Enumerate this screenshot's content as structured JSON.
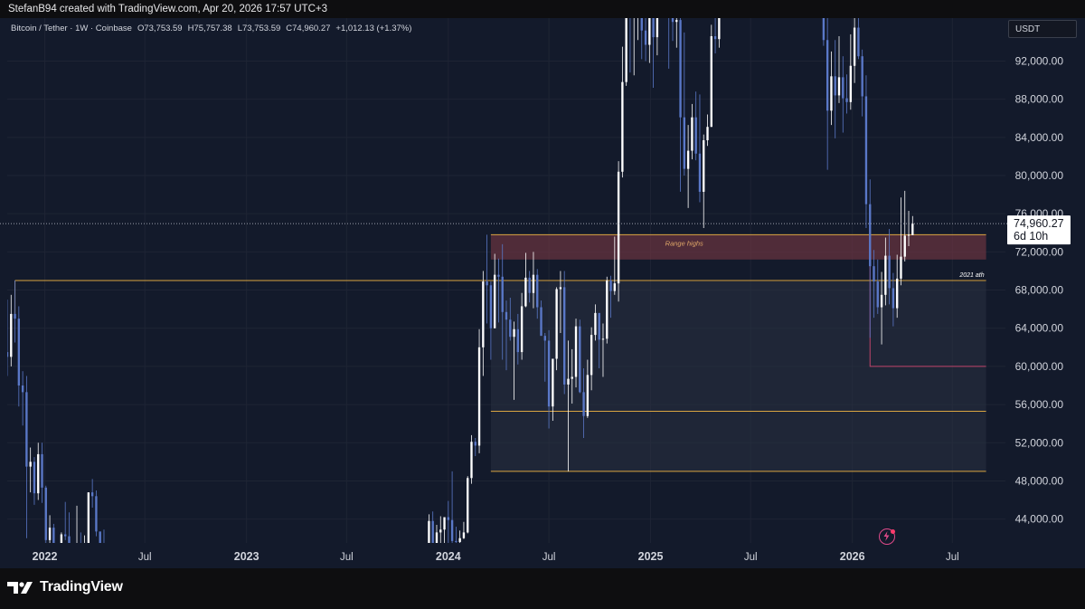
{
  "header": {
    "attribution": "StefanB94 created with TradingView.com, Apr 20, 2026 17:57 UTC+3"
  },
  "legend": {
    "symbol": "Bitcoin / Tether · 1W · Coinbase",
    "open": "O73,753.59",
    "high": "H75,757.38",
    "low": "L73,753.59",
    "close": "C74,960.27",
    "change": "+1,012.13 (+1.37%)"
  },
  "currency_button": "USDT",
  "price_tag": {
    "price": "74,960.27",
    "countdown": "6d 10h"
  },
  "footer": {
    "brand": "TradingView"
  },
  "colors": {
    "background": "#131a2b",
    "candle_up": "#ffffff",
    "candle_down": "#5a78c8",
    "range_highs_zone": "#6b3440",
    "level_line": "#d9a441",
    "low_box_border": "#c0446a"
  },
  "chart_data": {
    "type": "candlestick",
    "interval": "1W",
    "currency": "USDT",
    "y_ticks": [
      "44,000.00",
      "48,000.00",
      "52,000.00",
      "56,000.00",
      "60,000.00",
      "64,000.00",
      "68,000.00",
      "72,000.00",
      "76,000.00",
      "80,000.00",
      "84,000.00",
      "88,000.00",
      "92,000.00"
    ],
    "y_tick_values": [
      44000,
      48000,
      52000,
      56000,
      60000,
      64000,
      68000,
      72000,
      76000,
      80000,
      84000,
      88000,
      92000
    ],
    "ylim": [
      41500,
      96500
    ],
    "x_ticks": [
      {
        "label": "2022",
        "date": "2022-01-01",
        "bold": true
      },
      {
        "label": "Jul",
        "date": "2022-07-01",
        "bold": false
      },
      {
        "label": "2023",
        "date": "2023-01-01",
        "bold": true
      },
      {
        "label": "Jul",
        "date": "2023-07-01",
        "bold": false
      },
      {
        "label": "2024",
        "date": "2024-01-01",
        "bold": true
      },
      {
        "label": "Jul",
        "date": "2024-07-01",
        "bold": false
      },
      {
        "label": "2025",
        "date": "2025-01-01",
        "bold": true
      },
      {
        "label": "Jul",
        "date": "2025-07-01",
        "bold": false
      },
      {
        "label": "2026",
        "date": "2026-01-01",
        "bold": true
      },
      {
        "label": "Jul",
        "date": "2026-07-01",
        "bold": false
      }
    ],
    "xlim": [
      "2021-10-25",
      "2026-10-05"
    ],
    "last_price": 74960.27,
    "zones": [
      {
        "label": "Range highs",
        "from_date": "2024-03-18",
        "to_date": "2026-08-31",
        "y_low": 71200,
        "y_high": 73800
      },
      {
        "from_date": "2024-03-18",
        "to_date": "2026-08-31",
        "y_low": 49000,
        "y_high": 68900
      }
    ],
    "levels": [
      {
        "label": "2021 ath",
        "y": 69000,
        "from_date": "2021-11-08",
        "to_date": "2026-08-31"
      },
      {
        "y": 73800,
        "from_date": "2024-03-18",
        "to_date": "2026-08-31"
      },
      {
        "y": 55300,
        "from_date": "2024-03-18",
        "to_date": "2026-08-31"
      },
      {
        "y": 49000,
        "from_date": "2024-03-18",
        "to_date": "2026-08-31"
      }
    ],
    "box": {
      "from_date": "2026-02-02",
      "to_date": "2026-08-31",
      "y_top": 73800,
      "y_bottom": 60000
    },
    "candles": [
      {
        "date": "2021-10-25",
        "o": 61500,
        "h": 67000,
        "l": 59000,
        "c": 61000
      },
      {
        "date": "2021-11-01",
        "o": 61000,
        "h": 67500,
        "l": 60000,
        "c": 65500
      },
      {
        "date": "2021-11-08",
        "o": 65500,
        "h": 69000,
        "l": 62500,
        "c": 65000
      },
      {
        "date": "2021-11-15",
        "o": 65000,
        "h": 66300,
        "l": 55800,
        "c": 58000
      },
      {
        "date": "2021-11-22",
        "o": 58000,
        "h": 59500,
        "l": 53800,
        "c": 57300
      },
      {
        "date": "2021-11-29",
        "o": 57300,
        "h": 59000,
        "l": 42000,
        "c": 49500
      },
      {
        "date": "2021-12-06",
        "o": 49500,
        "h": 51500,
        "l": 46800,
        "c": 50000
      },
      {
        "date": "2021-12-13",
        "o": 50000,
        "h": 50500,
        "l": 45500,
        "c": 46700
      },
      {
        "date": "2021-12-20",
        "o": 46700,
        "h": 52000,
        "l": 46000,
        "c": 50800
      },
      {
        "date": "2021-12-27",
        "o": 50800,
        "h": 52000,
        "l": 45700,
        "c": 47300
      },
      {
        "date": "2022-01-03",
        "o": 47300,
        "h": 47500,
        "l": 40800,
        "c": 41800
      },
      {
        "date": "2022-01-10",
        "o": 41800,
        "h": 44400,
        "l": 39800,
        "c": 43100
      },
      {
        "date": "2022-01-17",
        "o": 43100,
        "h": 43500,
        "l": 34000,
        "c": 36300
      },
      {
        "date": "2022-01-24",
        "o": 36300,
        "h": 38900,
        "l": 33000,
        "c": 37900
      },
      {
        "date": "2022-01-31",
        "o": 37900,
        "h": 42600,
        "l": 36300,
        "c": 42400
      },
      {
        "date": "2022-02-07",
        "o": 42400,
        "h": 45800,
        "l": 41800,
        "c": 42200
      },
      {
        "date": "2022-02-14",
        "o": 42200,
        "h": 44700,
        "l": 38000,
        "c": 38300
      },
      {
        "date": "2022-02-21",
        "o": 38300,
        "h": 40000,
        "l": 34300,
        "c": 37700
      },
      {
        "date": "2022-02-28",
        "o": 37700,
        "h": 45400,
        "l": 37400,
        "c": 38400
      },
      {
        "date": "2022-03-07",
        "o": 38400,
        "h": 42600,
        "l": 37200,
        "c": 37800
      },
      {
        "date": "2022-03-14",
        "o": 37800,
        "h": 42300,
        "l": 37600,
        "c": 41300
      },
      {
        "date": "2022-03-21",
        "o": 41300,
        "h": 46800,
        "l": 40500,
        "c": 46800
      },
      {
        "date": "2022-03-28",
        "o": 46800,
        "h": 48200,
        "l": 45200,
        "c": 46400
      },
      {
        "date": "2022-04-04",
        "o": 46400,
        "h": 47000,
        "l": 42200,
        "c": 42700
      },
      {
        "date": "2022-04-11",
        "o": 42700,
        "h": 41500,
        "l": 38500,
        "c": 40400
      },
      {
        "date": "2022-04-18",
        "o": 40400,
        "h": 42900,
        "l": 38500,
        "c": 39400
      },
      {
        "date": "2023-11-27",
        "o": 37700,
        "h": 44500,
        "l": 37500,
        "c": 43800
      },
      {
        "date": "2023-12-04",
        "o": 43800,
        "h": 44800,
        "l": 40200,
        "c": 41400
      },
      {
        "date": "2023-12-11",
        "o": 41400,
        "h": 43400,
        "l": 40500,
        "c": 42600
      },
      {
        "date": "2023-12-18",
        "o": 42600,
        "h": 44300,
        "l": 40900,
        "c": 42900
      },
      {
        "date": "2023-12-25",
        "o": 42900,
        "h": 43800,
        "l": 41300,
        "c": 44200
      },
      {
        "date": "2024-01-01",
        "o": 44200,
        "h": 45900,
        "l": 40700,
        "c": 43900
      },
      {
        "date": "2024-01-08",
        "o": 43900,
        "h": 49000,
        "l": 41500,
        "c": 41700
      },
      {
        "date": "2024-01-15",
        "o": 41700,
        "h": 43200,
        "l": 40300,
        "c": 41600
      },
      {
        "date": "2024-01-22",
        "o": 41600,
        "h": 42800,
        "l": 38500,
        "c": 42000
      },
      {
        "date": "2024-01-29",
        "o": 42000,
        "h": 43700,
        "l": 41900,
        "c": 42600
      },
      {
        "date": "2024-02-05",
        "o": 42600,
        "h": 48500,
        "l": 42500,
        "c": 48300
      },
      {
        "date": "2024-02-12",
        "o": 48300,
        "h": 52800,
        "l": 47700,
        "c": 52100
      },
      {
        "date": "2024-02-19",
        "o": 52100,
        "h": 52500,
        "l": 50600,
        "c": 51700
      },
      {
        "date": "2024-02-26",
        "o": 51700,
        "h": 63900,
        "l": 50900,
        "c": 62000
      },
      {
        "date": "2024-03-04",
        "o": 62000,
        "h": 70000,
        "l": 59000,
        "c": 68900
      },
      {
        "date": "2024-03-11",
        "o": 68900,
        "h": 73800,
        "l": 64500,
        "c": 68500
      },
      {
        "date": "2024-03-18",
        "o": 68500,
        "h": 68900,
        "l": 60700,
        "c": 64000
      },
      {
        "date": "2024-03-25",
        "o": 64000,
        "h": 71800,
        "l": 64000,
        "c": 69600
      },
      {
        "date": "2024-04-01",
        "o": 69600,
        "h": 71300,
        "l": 64600,
        "c": 69400
      },
      {
        "date": "2024-04-08",
        "o": 69400,
        "h": 72800,
        "l": 60700,
        "c": 65700
      },
      {
        "date": "2024-04-15",
        "o": 65700,
        "h": 66900,
        "l": 59600,
        "c": 64900
      },
      {
        "date": "2024-04-22",
        "o": 64900,
        "h": 67200,
        "l": 62700,
        "c": 63100
      },
      {
        "date": "2024-04-29",
        "o": 63100,
        "h": 64700,
        "l": 56500,
        "c": 63900
      },
      {
        "date": "2024-05-06",
        "o": 63900,
        "h": 65500,
        "l": 60200,
        "c": 61500
      },
      {
        "date": "2024-05-13",
        "o": 61500,
        "h": 67700,
        "l": 60700,
        "c": 66300
      },
      {
        "date": "2024-05-20",
        "o": 66300,
        "h": 71900,
        "l": 66200,
        "c": 69300
      },
      {
        "date": "2024-05-27",
        "o": 69300,
        "h": 70000,
        "l": 66700,
        "c": 67700
      },
      {
        "date": "2024-06-03",
        "o": 67700,
        "h": 72000,
        "l": 66100,
        "c": 69600
      },
      {
        "date": "2024-06-10",
        "o": 69600,
        "h": 70200,
        "l": 65000,
        "c": 66200
      },
      {
        "date": "2024-06-17",
        "o": 66200,
        "h": 66900,
        "l": 63500,
        "c": 63200
      },
      {
        "date": "2024-06-24",
        "o": 63200,
        "h": 63500,
        "l": 58400,
        "c": 62700
      },
      {
        "date": "2024-07-01",
        "o": 62700,
        "h": 63800,
        "l": 53500,
        "c": 55800
      },
      {
        "date": "2024-07-08",
        "o": 55800,
        "h": 59500,
        "l": 54300,
        "c": 60800
      },
      {
        "date": "2024-07-15",
        "o": 60800,
        "h": 68300,
        "l": 59600,
        "c": 68100
      },
      {
        "date": "2024-07-22",
        "o": 68100,
        "h": 70000,
        "l": 63500,
        "c": 68300
      },
      {
        "date": "2024-07-29",
        "o": 68300,
        "h": 70000,
        "l": 57100,
        "c": 58100
      },
      {
        "date": "2024-08-05",
        "o": 58100,
        "h": 62700,
        "l": 49000,
        "c": 58700
      },
      {
        "date": "2024-08-12",
        "o": 58700,
        "h": 61800,
        "l": 56100,
        "c": 58900
      },
      {
        "date": "2024-08-19",
        "o": 58900,
        "h": 65000,
        "l": 57800,
        "c": 64200
      },
      {
        "date": "2024-08-26",
        "o": 64200,
        "h": 64900,
        "l": 57200,
        "c": 57300
      },
      {
        "date": "2024-09-02",
        "o": 57300,
        "h": 59800,
        "l": 52500,
        "c": 54800
      },
      {
        "date": "2024-09-09",
        "o": 54800,
        "h": 60700,
        "l": 54600,
        "c": 59100
      },
      {
        "date": "2024-09-16",
        "o": 59100,
        "h": 64100,
        "l": 57500,
        "c": 63300
      },
      {
        "date": "2024-09-23",
        "o": 63300,
        "h": 66500,
        "l": 62700,
        "c": 65600
      },
      {
        "date": "2024-09-30",
        "o": 65600,
        "h": 65500,
        "l": 59800,
        "c": 62800
      },
      {
        "date": "2024-10-07",
        "o": 62800,
        "h": 64500,
        "l": 58900,
        "c": 62900
      },
      {
        "date": "2024-10-14",
        "o": 62900,
        "h": 69400,
        "l": 62400,
        "c": 69000
      },
      {
        "date": "2024-10-21",
        "o": 69000,
        "h": 69500,
        "l": 65100,
        "c": 67900
      },
      {
        "date": "2024-10-28",
        "o": 67900,
        "h": 73600,
        "l": 67500,
        "c": 68700
      },
      {
        "date": "2024-11-04",
        "o": 68700,
        "h": 81500,
        "l": 66800,
        "c": 80400
      },
      {
        "date": "2024-11-11",
        "o": 80400,
        "h": 93500,
        "l": 79800,
        "c": 89800
      },
      {
        "date": "2024-11-18",
        "o": 89800,
        "h": 99800,
        "l": 89400,
        "c": 97900
      },
      {
        "date": "2024-11-25",
        "o": 97900,
        "h": 98900,
        "l": 90800,
        "c": 97300
      },
      {
        "date": "2024-12-02",
        "o": 97300,
        "h": 104000,
        "l": 90500,
        "c": 101200
      },
      {
        "date": "2024-12-09",
        "o": 101200,
        "h": 107800,
        "l": 94200,
        "c": 106000
      },
      {
        "date": "2024-12-16",
        "o": 106000,
        "h": 108300,
        "l": 92200,
        "c": 95200
      },
      {
        "date": "2024-12-23",
        "o": 95200,
        "h": 99900,
        "l": 92000,
        "c": 93700
      },
      {
        "date": "2024-12-30",
        "o": 93700,
        "h": 102700,
        "l": 91800,
        "c": 98300
      },
      {
        "date": "2025-01-06",
        "o": 98300,
        "h": 102300,
        "l": 89200,
        "c": 94500
      },
      {
        "date": "2025-01-13",
        "o": 94500,
        "h": 106400,
        "l": 92600,
        "c": 101300
      },
      {
        "date": "2025-01-20",
        "o": 101300,
        "h": 109600,
        "l": 99600,
        "c": 104700
      },
      {
        "date": "2025-01-27",
        "o": 104700,
        "h": 106500,
        "l": 97700,
        "c": 97700
      },
      {
        "date": "2025-02-03",
        "o": 97700,
        "h": 102500,
        "l": 91200,
        "c": 96500
      },
      {
        "date": "2025-02-10",
        "o": 96500,
        "h": 98800,
        "l": 94100,
        "c": 96100
      },
      {
        "date": "2025-02-17",
        "o": 96100,
        "h": 99500,
        "l": 93400,
        "c": 96300
      },
      {
        "date": "2025-02-24",
        "o": 96300,
        "h": 96500,
        "l": 78300,
        "c": 86100
      },
      {
        "date": "2025-03-03",
        "o": 86100,
        "h": 95000,
        "l": 80000,
        "c": 80700
      },
      {
        "date": "2025-03-10",
        "o": 80700,
        "h": 85300,
        "l": 76600,
        "c": 82600
      },
      {
        "date": "2025-03-17",
        "o": 82600,
        "h": 87500,
        "l": 81700,
        "c": 86100
      },
      {
        "date": "2025-03-24",
        "o": 86100,
        "h": 88800,
        "l": 81600,
        "c": 82300
      },
      {
        "date": "2025-03-31",
        "o": 82300,
        "h": 88500,
        "l": 77200,
        "c": 78300
      },
      {
        "date": "2025-04-07",
        "o": 78300,
        "h": 84300,
        "l": 74500,
        "c": 83700
      },
      {
        "date": "2025-04-14",
        "o": 83700,
        "h": 86400,
        "l": 83100,
        "c": 85100
      },
      {
        "date": "2025-04-21",
        "o": 85100,
        "h": 95800,
        "l": 85100,
        "c": 94600
      },
      {
        "date": "2025-04-28",
        "o": 94600,
        "h": 97900,
        "l": 92800,
        "c": 94300
      },
      {
        "date": "2025-05-05",
        "o": 94300,
        "h": 104300,
        "l": 93400,
        "c": 104100
      },
      {
        "date": "2025-05-12",
        "o": 104100,
        "h": 106600,
        "l": 100700,
        "c": 106400
      },
      {
        "date": "2025-10-27",
        "o": 114500,
        "h": 116400,
        "l": 106300,
        "c": 110600
      },
      {
        "date": "2025-11-03",
        "o": 110600,
        "h": 110800,
        "l": 98900,
        "c": 104700
      },
      {
        "date": "2025-11-10",
        "o": 104700,
        "h": 107500,
        "l": 93600,
        "c": 94200
      },
      {
        "date": "2025-11-17",
        "o": 94200,
        "h": 96700,
        "l": 80600,
        "c": 86800
      },
      {
        "date": "2025-11-24",
        "o": 86800,
        "h": 93000,
        "l": 85300,
        "c": 90400
      },
      {
        "date": "2025-12-01",
        "o": 90400,
        "h": 94200,
        "l": 83900,
        "c": 88400
      },
      {
        "date": "2025-12-08",
        "o": 88400,
        "h": 94600,
        "l": 87600,
        "c": 90300
      },
      {
        "date": "2025-12-15",
        "o": 90300,
        "h": 92500,
        "l": 84500,
        "c": 88100
      },
      {
        "date": "2025-12-22",
        "o": 88100,
        "h": 90600,
        "l": 86500,
        "c": 87700
      },
      {
        "date": "2025-12-29",
        "o": 87700,
        "h": 94800,
        "l": 86900,
        "c": 91500
      },
      {
        "date": "2026-01-05",
        "o": 91500,
        "h": 97900,
        "l": 89700,
        "c": 95500
      },
      {
        "date": "2026-01-12",
        "o": 95500,
        "h": 97800,
        "l": 92200,
        "c": 92500
      },
      {
        "date": "2026-01-19",
        "o": 92500,
        "h": 93200,
        "l": 86200,
        "c": 88300
      },
      {
        "date": "2026-01-26",
        "o": 88300,
        "h": 90500,
        "l": 74500,
        "c": 77000
      },
      {
        "date": "2026-02-02",
        "o": 77000,
        "h": 79600,
        "l": 63000,
        "c": 70500
      },
      {
        "date": "2026-02-09",
        "o": 70500,
        "h": 72200,
        "l": 65100,
        "c": 68900
      },
      {
        "date": "2026-02-16",
        "o": 68900,
        "h": 71200,
        "l": 65500,
        "c": 66200
      },
      {
        "date": "2026-02-23",
        "o": 66200,
        "h": 69900,
        "l": 62300,
        "c": 67500
      },
      {
        "date": "2026-03-02",
        "o": 67500,
        "h": 73500,
        "l": 66400,
        "c": 71600
      },
      {
        "date": "2026-03-09",
        "o": 71600,
        "h": 74400,
        "l": 66500,
        "c": 68200
      },
      {
        "date": "2026-03-16",
        "o": 68200,
        "h": 69800,
        "l": 64200,
        "c": 66100
      },
      {
        "date": "2026-03-23",
        "o": 66100,
        "h": 71700,
        "l": 65100,
        "c": 69200
      },
      {
        "date": "2026-03-30",
        "o": 69200,
        "h": 77700,
        "l": 68500,
        "c": 71500
      },
      {
        "date": "2026-04-06",
        "o": 71500,
        "h": 78400,
        "l": 71000,
        "c": 73700
      },
      {
        "date": "2026-04-13",
        "o": 73700,
        "h": 76300,
        "l": 72600,
        "c": 73800
      },
      {
        "date": "2026-04-20",
        "o": 73754,
        "h": 75757,
        "l": 73754,
        "c": 74960
      }
    ]
  }
}
